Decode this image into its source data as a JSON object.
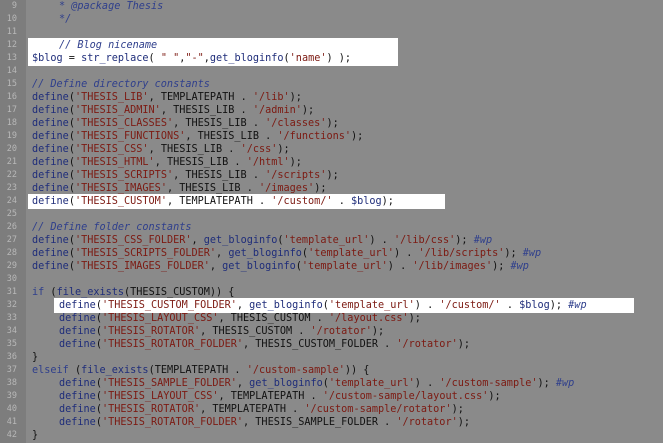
{
  "editor": {
    "lines": [
      {
        "n": "9",
        "indent": 1,
        "tokens": [
          {
            "t": "* @package Thesis",
            "c": "c"
          }
        ]
      },
      {
        "n": "10",
        "indent": 1,
        "tokens": [
          {
            "t": "*/",
            "c": "c"
          }
        ]
      },
      {
        "n": "11",
        "indent": 0,
        "tokens": []
      },
      {
        "n": "12",
        "indent": 1,
        "tokens": [
          {
            "t": "// Blog nicename",
            "c": "c"
          }
        ]
      },
      {
        "n": "13",
        "indent": 0,
        "tokens": [
          {
            "t": "$blog",
            "c": "v"
          },
          {
            "t": " = ",
            "c": "t"
          },
          {
            "t": "str_replace",
            "c": "f"
          },
          {
            "t": "( ",
            "c": "t"
          },
          {
            "t": "\" \"",
            "c": "s"
          },
          {
            "t": ",",
            "c": "t"
          },
          {
            "t": "\"-\"",
            "c": "s"
          },
          {
            "t": ",",
            "c": "t"
          },
          {
            "t": "get_bloginfo",
            "c": "f"
          },
          {
            "t": "(",
            "c": "t"
          },
          {
            "t": "'name'",
            "c": "s"
          },
          {
            "t": ") );",
            "c": "t"
          }
        ]
      },
      {
        "n": "14",
        "indent": 0,
        "tokens": []
      },
      {
        "n": "15",
        "indent": 0,
        "tokens": [
          {
            "t": "// Define directory constants",
            "c": "c"
          }
        ]
      },
      {
        "n": "16",
        "indent": 0,
        "tokens": [
          {
            "t": "define",
            "c": "f"
          },
          {
            "t": "(",
            "c": "t"
          },
          {
            "t": "'THESIS_LIB'",
            "c": "s"
          },
          {
            "t": ", TEMPLATEPATH . ",
            "c": "t"
          },
          {
            "t": "'/lib'",
            "c": "s"
          },
          {
            "t": ");",
            "c": "t"
          }
        ]
      },
      {
        "n": "17",
        "indent": 0,
        "tokens": [
          {
            "t": "define",
            "c": "f"
          },
          {
            "t": "(",
            "c": "t"
          },
          {
            "t": "'THESIS_ADMIN'",
            "c": "s"
          },
          {
            "t": ", THESIS_LIB . ",
            "c": "t"
          },
          {
            "t": "'/admin'",
            "c": "s"
          },
          {
            "t": ");",
            "c": "t"
          }
        ]
      },
      {
        "n": "18",
        "indent": 0,
        "tokens": [
          {
            "t": "define",
            "c": "f"
          },
          {
            "t": "(",
            "c": "t"
          },
          {
            "t": "'THESIS_CLASSES'",
            "c": "s"
          },
          {
            "t": ", THESIS_LIB . ",
            "c": "t"
          },
          {
            "t": "'/classes'",
            "c": "s"
          },
          {
            "t": ");",
            "c": "t"
          }
        ]
      },
      {
        "n": "19",
        "indent": 0,
        "tokens": [
          {
            "t": "define",
            "c": "f"
          },
          {
            "t": "(",
            "c": "t"
          },
          {
            "t": "'THESIS_FUNCTIONS'",
            "c": "s"
          },
          {
            "t": ", THESIS_LIB . ",
            "c": "t"
          },
          {
            "t": "'/functions'",
            "c": "s"
          },
          {
            "t": ");",
            "c": "t"
          }
        ]
      },
      {
        "n": "20",
        "indent": 0,
        "tokens": [
          {
            "t": "define",
            "c": "f"
          },
          {
            "t": "(",
            "c": "t"
          },
          {
            "t": "'THESIS_CSS'",
            "c": "s"
          },
          {
            "t": ", THESIS_LIB . ",
            "c": "t"
          },
          {
            "t": "'/css'",
            "c": "s"
          },
          {
            "t": ");",
            "c": "t"
          }
        ]
      },
      {
        "n": "21",
        "indent": 0,
        "tokens": [
          {
            "t": "define",
            "c": "f"
          },
          {
            "t": "(",
            "c": "t"
          },
          {
            "t": "'THESIS_HTML'",
            "c": "s"
          },
          {
            "t": ", THESIS_LIB . ",
            "c": "t"
          },
          {
            "t": "'/html'",
            "c": "s"
          },
          {
            "t": ");",
            "c": "t"
          }
        ]
      },
      {
        "n": "22",
        "indent": 0,
        "tokens": [
          {
            "t": "define",
            "c": "f"
          },
          {
            "t": "(",
            "c": "t"
          },
          {
            "t": "'THESIS_SCRIPTS'",
            "c": "s"
          },
          {
            "t": ", THESIS_LIB . ",
            "c": "t"
          },
          {
            "t": "'/scripts'",
            "c": "s"
          },
          {
            "t": ");",
            "c": "t"
          }
        ]
      },
      {
        "n": "23",
        "indent": 0,
        "tokens": [
          {
            "t": "define",
            "c": "f"
          },
          {
            "t": "(",
            "c": "t"
          },
          {
            "t": "'THESIS_IMAGES'",
            "c": "s"
          },
          {
            "t": ", THESIS_LIB . ",
            "c": "t"
          },
          {
            "t": "'/images'",
            "c": "s"
          },
          {
            "t": ");",
            "c": "t"
          }
        ]
      },
      {
        "n": "24",
        "indent": 0,
        "tokens": [
          {
            "t": "define",
            "c": "f"
          },
          {
            "t": "(",
            "c": "t"
          },
          {
            "t": "'THESIS_CUSTOM'",
            "c": "s"
          },
          {
            "t": ", TEMPLATEPATH . ",
            "c": "t"
          },
          {
            "t": "'/custom/'",
            "c": "s"
          },
          {
            "t": " . ",
            "c": "t"
          },
          {
            "t": "$blog",
            "c": "v"
          },
          {
            "t": ");",
            "c": "t"
          }
        ]
      },
      {
        "n": "25",
        "indent": 0,
        "tokens": []
      },
      {
        "n": "26",
        "indent": 0,
        "tokens": [
          {
            "t": "// Define folder constants",
            "c": "c"
          }
        ]
      },
      {
        "n": "27",
        "indent": 0,
        "tokens": [
          {
            "t": "define",
            "c": "f"
          },
          {
            "t": "(",
            "c": "t"
          },
          {
            "t": "'THESIS_CSS_FOLDER'",
            "c": "s"
          },
          {
            "t": ", ",
            "c": "t"
          },
          {
            "t": "get_bloginfo",
            "c": "f"
          },
          {
            "t": "(",
            "c": "t"
          },
          {
            "t": "'template_url'",
            "c": "s"
          },
          {
            "t": ") . ",
            "c": "t"
          },
          {
            "t": "'/lib/css'",
            "c": "s"
          },
          {
            "t": "); ",
            "c": "t"
          },
          {
            "t": "#wp",
            "c": "c"
          }
        ]
      },
      {
        "n": "28",
        "indent": 0,
        "tokens": [
          {
            "t": "define",
            "c": "f"
          },
          {
            "t": "(",
            "c": "t"
          },
          {
            "t": "'THESIS_SCRIPTS_FOLDER'",
            "c": "s"
          },
          {
            "t": ", ",
            "c": "t"
          },
          {
            "t": "get_bloginfo",
            "c": "f"
          },
          {
            "t": "(",
            "c": "t"
          },
          {
            "t": "'template_url'",
            "c": "s"
          },
          {
            "t": ") . ",
            "c": "t"
          },
          {
            "t": "'/lib/scripts'",
            "c": "s"
          },
          {
            "t": "); ",
            "c": "t"
          },
          {
            "t": "#wp",
            "c": "c"
          }
        ]
      },
      {
        "n": "29",
        "indent": 0,
        "tokens": [
          {
            "t": "define",
            "c": "f"
          },
          {
            "t": "(",
            "c": "t"
          },
          {
            "t": "'THESIS_IMAGES_FOLDER'",
            "c": "s"
          },
          {
            "t": ", ",
            "c": "t"
          },
          {
            "t": "get_bloginfo",
            "c": "f"
          },
          {
            "t": "(",
            "c": "t"
          },
          {
            "t": "'template_url'",
            "c": "s"
          },
          {
            "t": ") . ",
            "c": "t"
          },
          {
            "t": "'/lib/images'",
            "c": "s"
          },
          {
            "t": "); ",
            "c": "t"
          },
          {
            "t": "#wp",
            "c": "c"
          }
        ]
      },
      {
        "n": "30",
        "indent": 0,
        "tokens": []
      },
      {
        "n": "31",
        "indent": 0,
        "tokens": [
          {
            "t": "if",
            "c": "k"
          },
          {
            "t": " (",
            "c": "t"
          },
          {
            "t": "file_exists",
            "c": "f"
          },
          {
            "t": "(THESIS_CUSTOM)) {",
            "c": "t"
          }
        ]
      },
      {
        "n": "32",
        "indent": 1,
        "tokens": [
          {
            "t": "define",
            "c": "f"
          },
          {
            "t": "(",
            "c": "t"
          },
          {
            "t": "'THESIS_CUSTOM_FOLDER'",
            "c": "s"
          },
          {
            "t": ", ",
            "c": "t"
          },
          {
            "t": "get_bloginfo",
            "c": "f"
          },
          {
            "t": "(",
            "c": "t"
          },
          {
            "t": "'template_url'",
            "c": "s"
          },
          {
            "t": ") . ",
            "c": "t"
          },
          {
            "t": "'/custom/'",
            "c": "s"
          },
          {
            "t": " . ",
            "c": "t"
          },
          {
            "t": "$blog",
            "c": "v"
          },
          {
            "t": "); ",
            "c": "t"
          },
          {
            "t": "#wp",
            "c": "c"
          }
        ]
      },
      {
        "n": "33",
        "indent": 1,
        "tokens": [
          {
            "t": "define",
            "c": "f"
          },
          {
            "t": "(",
            "c": "t"
          },
          {
            "t": "'THESIS_LAYOUT_CSS'",
            "c": "s"
          },
          {
            "t": ", THESIS_CUSTOM . ",
            "c": "t"
          },
          {
            "t": "'/layout.css'",
            "c": "s"
          },
          {
            "t": ");",
            "c": "t"
          }
        ]
      },
      {
        "n": "34",
        "indent": 1,
        "tokens": [
          {
            "t": "define",
            "c": "f"
          },
          {
            "t": "(",
            "c": "t"
          },
          {
            "t": "'THESIS_ROTATOR'",
            "c": "s"
          },
          {
            "t": ", THESIS_CUSTOM . ",
            "c": "t"
          },
          {
            "t": "'/rotator'",
            "c": "s"
          },
          {
            "t": ");",
            "c": "t"
          }
        ]
      },
      {
        "n": "35",
        "indent": 1,
        "tokens": [
          {
            "t": "define",
            "c": "f"
          },
          {
            "t": "(",
            "c": "t"
          },
          {
            "t": "'THESIS_ROTATOR_FOLDER'",
            "c": "s"
          },
          {
            "t": ", THESIS_CUSTOM_FOLDER . ",
            "c": "t"
          },
          {
            "t": "'/rotator'",
            "c": "s"
          },
          {
            "t": ");",
            "c": "t"
          }
        ]
      },
      {
        "n": "36",
        "indent": 0,
        "tokens": [
          {
            "t": "}",
            "c": "t"
          }
        ]
      },
      {
        "n": "37",
        "indent": 0,
        "tokens": [
          {
            "t": "elseif",
            "c": "k"
          },
          {
            "t": " (",
            "c": "t"
          },
          {
            "t": "file_exists",
            "c": "f"
          },
          {
            "t": "(TEMPLATEPATH . ",
            "c": "t"
          },
          {
            "t": "'/custom-sample'",
            "c": "s"
          },
          {
            "t": ")) {",
            "c": "t"
          }
        ]
      },
      {
        "n": "38",
        "indent": 1,
        "tokens": [
          {
            "t": "define",
            "c": "f"
          },
          {
            "t": "(",
            "c": "t"
          },
          {
            "t": "'THESIS_SAMPLE_FOLDER'",
            "c": "s"
          },
          {
            "t": ", ",
            "c": "t"
          },
          {
            "t": "get_bloginfo",
            "c": "f"
          },
          {
            "t": "(",
            "c": "t"
          },
          {
            "t": "'template_url'",
            "c": "s"
          },
          {
            "t": ") . ",
            "c": "t"
          },
          {
            "t": "'/custom-sample'",
            "c": "s"
          },
          {
            "t": "); ",
            "c": "t"
          },
          {
            "t": "#wp",
            "c": "c"
          }
        ]
      },
      {
        "n": "39",
        "indent": 1,
        "tokens": [
          {
            "t": "define",
            "c": "f"
          },
          {
            "t": "(",
            "c": "t"
          },
          {
            "t": "'THESIS_LAYOUT_CSS'",
            "c": "s"
          },
          {
            "t": ", TEMPLATEPATH . ",
            "c": "t"
          },
          {
            "t": "'/custom-sample/layout.css'",
            "c": "s"
          },
          {
            "t": ");",
            "c": "t"
          }
        ]
      },
      {
        "n": "40",
        "indent": 1,
        "tokens": [
          {
            "t": "define",
            "c": "f"
          },
          {
            "t": "(",
            "c": "t"
          },
          {
            "t": "'THESIS_ROTATOR'",
            "c": "s"
          },
          {
            "t": ", TEMPLATEPATH . ",
            "c": "t"
          },
          {
            "t": "'/custom-sample/rotator'",
            "c": "s"
          },
          {
            "t": ");",
            "c": "t"
          }
        ]
      },
      {
        "n": "41",
        "indent": 1,
        "tokens": [
          {
            "t": "define",
            "c": "f"
          },
          {
            "t": "(",
            "c": "t"
          },
          {
            "t": "'THESIS_ROTATOR_FOLDER'",
            "c": "s"
          },
          {
            "t": ", THESIS_SAMPLE_FOLDER . ",
            "c": "t"
          },
          {
            "t": "'/rotator'",
            "c": "s"
          },
          {
            "t": ");",
            "c": "t"
          }
        ]
      },
      {
        "n": "42",
        "indent": 0,
        "tokens": [
          {
            "t": "}",
            "c": "t"
          }
        ]
      }
    ],
    "highlighted_lines": [
      "12",
      "13",
      "24",
      "32"
    ]
  }
}
